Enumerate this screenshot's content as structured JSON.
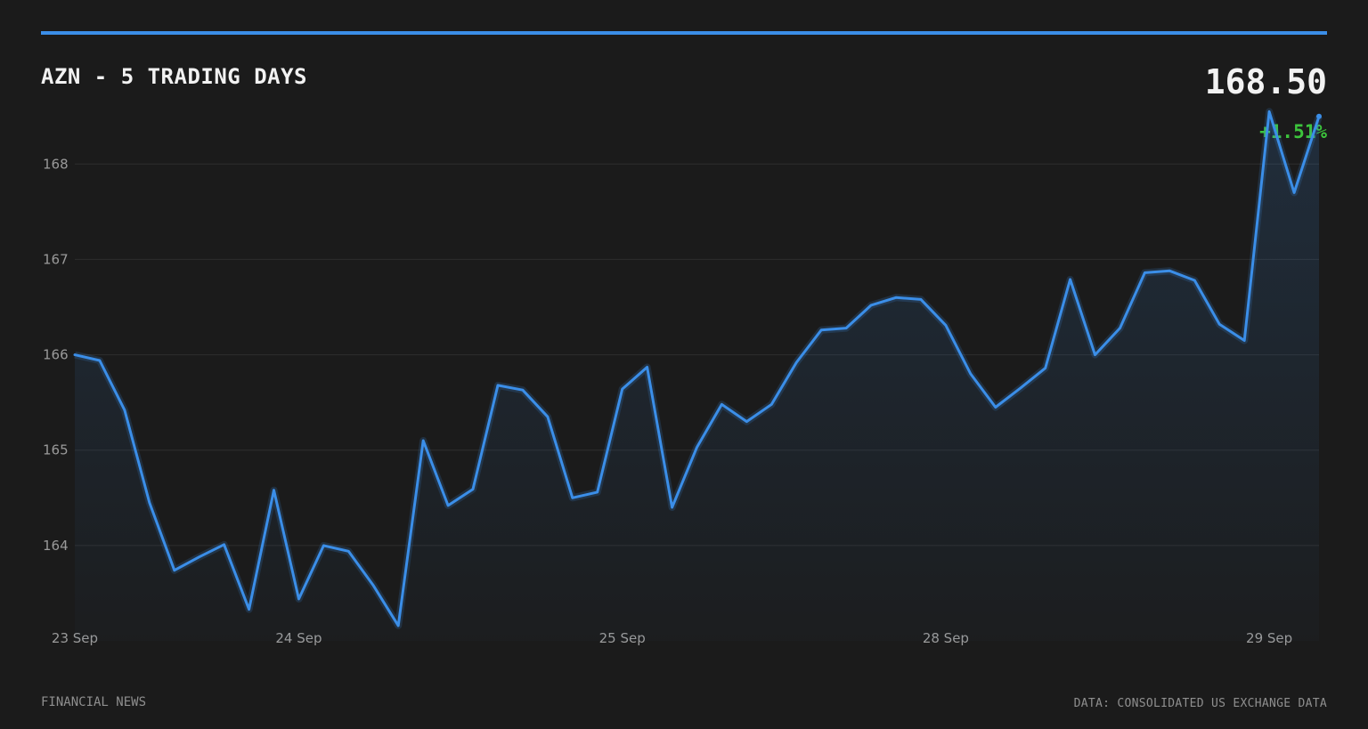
{
  "header": {
    "title": "AZN - 5 TRADING DAYS",
    "price": "168.50",
    "change": "+1.51%"
  },
  "footer": {
    "source_left": "FINANCIAL NEWS",
    "source_right": "DATA: CONSOLIDATED US EXCHANGE DATA"
  },
  "colors": {
    "background": "#1b1b1b",
    "accent": "#3b8ee8",
    "line": "#3b8ee8",
    "positive": "#3cc43c",
    "grid": "#2e2e2e",
    "tick": "#9a9a9a"
  },
  "chart_data": {
    "type": "area",
    "ylim": [
      163.0,
      168.6
    ],
    "yticks": [
      164,
      165,
      166,
      167,
      168
    ],
    "grid": true,
    "x_tick_labels": [
      {
        "label": "23 Sep",
        "index": 0
      },
      {
        "label": "24 Sep",
        "index": 9
      },
      {
        "label": "25 Sep",
        "index": 22
      },
      {
        "label": "28 Sep",
        "index": 35
      },
      {
        "label": "29 Sep",
        "index": 48
      }
    ],
    "values": [
      166.0,
      165.94,
      165.42,
      164.45,
      163.74,
      163.88,
      164.01,
      163.33,
      164.58,
      163.44,
      164.0,
      163.94,
      163.58,
      163.16,
      165.1,
      164.42,
      164.59,
      165.68,
      165.63,
      165.35,
      164.5,
      164.56,
      165.64,
      165.87,
      164.4,
      165.03,
      165.48,
      165.3,
      165.48,
      165.92,
      166.26,
      166.28,
      166.52,
      166.6,
      166.58,
      166.31,
      165.8,
      165.45,
      165.65,
      165.86,
      166.79,
      166.0,
      166.28,
      166.86,
      166.88,
      166.78,
      166.32,
      166.15,
      168.55,
      167.7,
      168.5
    ]
  }
}
